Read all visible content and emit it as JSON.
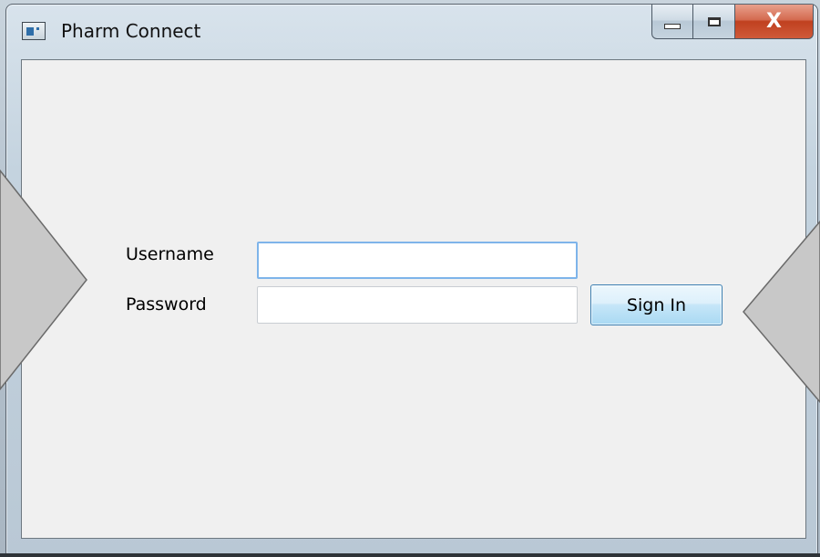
{
  "window": {
    "title": "Pharm Connect",
    "icon": "application-window-icon",
    "caption_buttons": {
      "minimize": "minimize-icon",
      "maximize": "maximize-icon",
      "close_label": "X"
    }
  },
  "form": {
    "username_label": "Username",
    "username_value": "",
    "password_label": "Password",
    "password_value": "",
    "sign_in_label": "Sign In"
  },
  "colors": {
    "client_background": "#f0f0f0",
    "focus_border": "#7eb4ea",
    "button_border": "#3c7fb1",
    "close_button": "#c0401f",
    "overlay_arrow": "#c8c8c8"
  }
}
